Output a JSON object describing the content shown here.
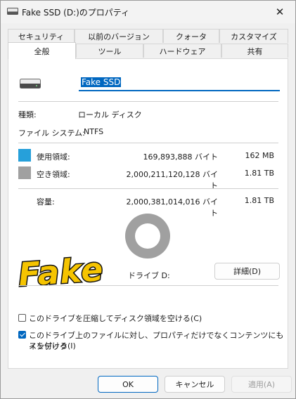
{
  "window": {
    "title": "Fake SSD (D:)のプロパティ",
    "close_glyph": "✕"
  },
  "tabs_row1": [
    "セキュリティ",
    "以前のバージョン",
    "クォータ",
    "カスタマイズ"
  ],
  "tabs_row2": [
    "全般",
    "ツール",
    "ハードウェア",
    "共有"
  ],
  "active_tab": "全般",
  "general": {
    "drive_name_value": "Fake SSD",
    "type_label": "種類:",
    "type_value": "ローカル ディスク",
    "fs_label": "ファイル システム:",
    "fs_value": "NTFS",
    "used_label": "使用領域:",
    "used_bytes": "169,893,888 バイト",
    "used_size": "162 MB",
    "free_label": "空き領域:",
    "free_bytes": "2,000,211,120,128 バイト",
    "free_size": "1.81 TB",
    "capacity_label": "容量:",
    "capacity_bytes": "2,000,381,014,016 バイト",
    "capacity_size": "1.81 TB",
    "drive_label": "ドライブ D:",
    "details_button": "詳細(D)",
    "overlay_text": "Fake",
    "compress_label": "このドライブを圧縮してディスク領域を空ける(C)",
    "compress_checked": false,
    "index_label_line1": "このドライブ上のファイルに対し、プロパティだけでなくコンテンツにもインデック",
    "index_label_line2": "スを付ける(I)",
    "index_checked": true
  },
  "chart_data": {
    "type": "pie",
    "categories": [
      "使用領域",
      "空き領域"
    ],
    "values": [
      169893888,
      2000211120128
    ]
  },
  "colors": {
    "used": "#26a0da",
    "free": "#a0a0a0",
    "accent": "#0067c0"
  },
  "footer": {
    "ok": "OK",
    "cancel": "キャンセル",
    "apply": "適用(A)"
  }
}
